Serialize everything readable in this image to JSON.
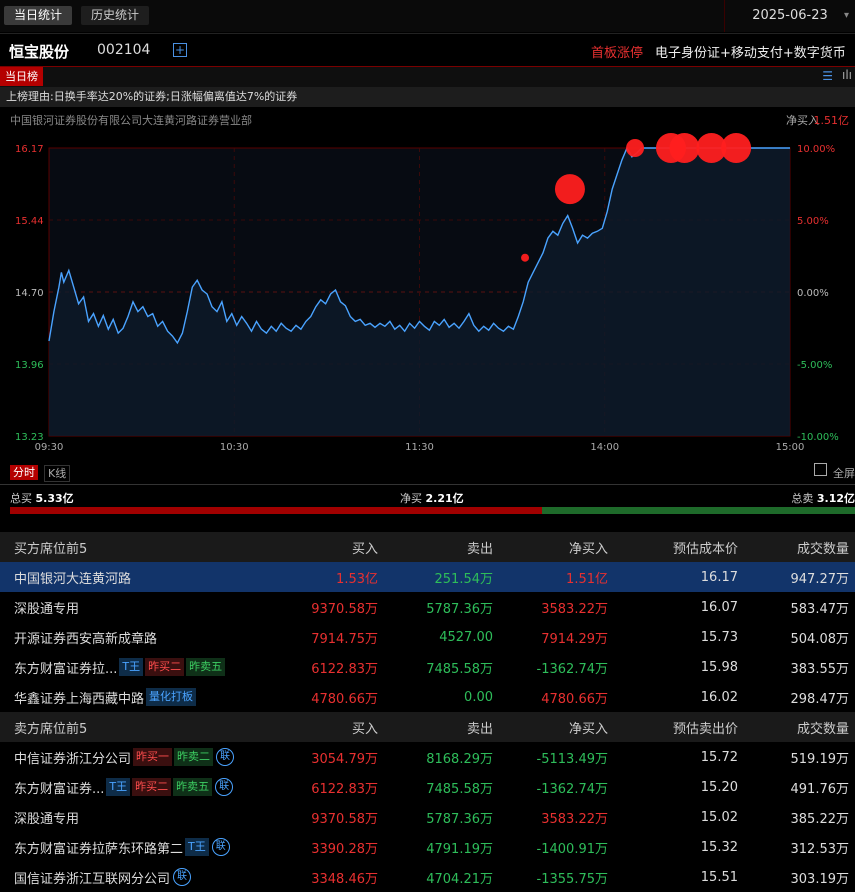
{
  "tabs": {
    "today": "当日统计",
    "history": "历史统计"
  },
  "date": "2025-06-23",
  "stock": {
    "name": "恒宝股份",
    "code": "002104",
    "status": "首板涨停",
    "concepts": "电子身份证+移动支付+数字货币"
  },
  "list_tag": "当日榜",
  "reason": "上榜理由:日换手率达20%的证券;日涨幅偏离值达7%的证券",
  "branch": {
    "name": "中国银河证券股份有限公司大连黄河路证券营业部",
    "net_label": "净买入",
    "net_value": "1.51亿"
  },
  "colors": {
    "up": "#e83030",
    "down": "#2ebd5a",
    "line": "#4aa3ff",
    "highlight": "#12346a"
  },
  "chart_data": {
    "type": "line",
    "y_left_ticks": [
      "16.17",
      "15.44",
      "14.70",
      "13.96",
      "13.23"
    ],
    "y_right_ticks": [
      "10.00%",
      "5.00%",
      "0.00%",
      "-5.00%",
      "-10.00%"
    ],
    "x_ticks": [
      "09:30",
      "10:30",
      "11:30",
      "14:00",
      "15:00"
    ],
    "ylim": [
      13.23,
      16.17
    ],
    "prev_close": 14.7,
    "series": [
      {
        "points": [
          [
            0,
            14.2
          ],
          [
            2,
            14.5
          ],
          [
            4,
            14.75
          ],
          [
            5,
            14.9
          ],
          [
            6,
            14.8
          ],
          [
            8,
            14.92
          ],
          [
            10,
            14.75
          ],
          [
            12,
            14.58
          ],
          [
            14,
            14.65
          ],
          [
            16,
            14.4
          ],
          [
            18,
            14.48
          ],
          [
            20,
            14.35
          ],
          [
            22,
            14.46
          ],
          [
            24,
            14.32
          ],
          [
            26,
            14.42
          ],
          [
            28,
            14.28
          ],
          [
            30,
            14.33
          ],
          [
            32,
            14.45
          ],
          [
            34,
            14.6
          ],
          [
            36,
            14.5
          ],
          [
            38,
            14.55
          ],
          [
            40,
            14.45
          ],
          [
            42,
            14.48
          ],
          [
            44,
            14.35
          ],
          [
            46,
            14.4
          ],
          [
            48,
            14.3
          ],
          [
            50,
            14.25
          ],
          [
            52,
            14.18
          ],
          [
            54,
            14.28
          ],
          [
            56,
            14.5
          ],
          [
            58,
            14.75
          ],
          [
            60,
            14.82
          ],
          [
            62,
            14.72
          ],
          [
            64,
            14.68
          ],
          [
            66,
            14.55
          ],
          [
            68,
            14.5
          ],
          [
            70,
            14.6
          ],
          [
            72,
            14.4
          ],
          [
            74,
            14.48
          ],
          [
            76,
            14.36
          ],
          [
            78,
            14.45
          ],
          [
            80,
            14.38
          ],
          [
            82,
            14.3
          ],
          [
            84,
            14.4
          ],
          [
            86,
            14.32
          ],
          [
            88,
            14.28
          ],
          [
            90,
            14.35
          ],
          [
            92,
            14.3
          ],
          [
            94,
            14.38
          ],
          [
            96,
            14.33
          ],
          [
            98,
            14.3
          ],
          [
            100,
            14.36
          ],
          [
            102,
            14.32
          ],
          [
            104,
            14.4
          ],
          [
            106,
            14.45
          ],
          [
            108,
            14.55
          ],
          [
            110,
            14.62
          ],
          [
            112,
            14.58
          ],
          [
            114,
            14.68
          ],
          [
            116,
            14.72
          ],
          [
            118,
            14.6
          ],
          [
            120,
            14.56
          ],
          [
            122,
            14.45
          ],
          [
            124,
            14.4
          ],
          [
            126,
            14.42
          ],
          [
            128,
            14.36
          ],
          [
            130,
            14.38
          ],
          [
            132,
            14.34
          ],
          [
            134,
            14.38
          ],
          [
            136,
            14.35
          ],
          [
            138,
            14.4
          ],
          [
            140,
            14.32
          ],
          [
            142,
            14.36
          ],
          [
            144,
            14.3
          ],
          [
            146,
            14.38
          ],
          [
            148,
            14.33
          ],
          [
            150,
            14.4
          ],
          [
            152,
            14.35
          ],
          [
            154,
            14.31
          ],
          [
            156,
            14.4
          ],
          [
            158,
            14.36
          ],
          [
            160,
            14.42
          ],
          [
            162,
            14.34
          ],
          [
            164,
            14.38
          ],
          [
            166,
            14.33
          ],
          [
            168,
            14.4
          ],
          [
            170,
            14.48
          ],
          [
            172,
            14.36
          ],
          [
            174,
            14.3
          ],
          [
            176,
            14.35
          ],
          [
            178,
            14.31
          ],
          [
            180,
            14.38
          ],
          [
            182,
            14.33
          ],
          [
            184,
            14.3
          ],
          [
            186,
            14.35
          ],
          [
            188,
            14.32
          ],
          [
            190,
            14.45
          ],
          [
            192,
            14.6
          ],
          [
            194,
            14.8
          ],
          [
            196,
            14.9
          ],
          [
            198,
            15.0
          ],
          [
            200,
            15.1
          ],
          [
            202,
            15.25
          ],
          [
            204,
            15.32
          ],
          [
            206,
            15.28
          ],
          [
            208,
            15.4
          ],
          [
            210,
            15.48
          ],
          [
            212,
            15.35
          ],
          [
            214,
            15.2
          ],
          [
            216,
            15.28
          ],
          [
            218,
            15.25
          ],
          [
            220,
            15.3
          ],
          [
            222,
            15.32
          ],
          [
            224,
            15.35
          ],
          [
            226,
            15.52
          ],
          [
            228,
            15.75
          ],
          [
            230,
            15.9
          ],
          [
            232,
            16.05
          ],
          [
            234,
            16.17
          ],
          [
            236,
            16.08
          ],
          [
            238,
            16.12
          ],
          [
            240,
            16.17
          ],
          [
            300,
            16.17
          ]
        ],
        "markers": [
          {
            "t": 212,
            "v": 15.05,
            "size": "small"
          },
          {
            "t": 232,
            "v": 15.75,
            "size": "large"
          },
          {
            "t": 261,
            "v": 16.17,
            "size": "medium"
          },
          {
            "t": 277,
            "v": 16.17,
            "size": "large"
          },
          {
            "t": 283,
            "v": 16.17,
            "size": "large"
          },
          {
            "t": 295,
            "v": 16.17,
            "size": "large"
          },
          {
            "t": 306,
            "v": 16.17,
            "size": "large"
          }
        ]
      }
    ]
  },
  "modes": {
    "minute": "分时",
    "kline": "K线",
    "fullscreen": "全屏"
  },
  "summary": {
    "total_buy_label": "总买",
    "total_buy": "5.33亿",
    "net_label": "净买",
    "net": "2.21亿",
    "total_sell_label": "总卖",
    "total_sell": "3.12亿",
    "buy_ratio": 0.63
  },
  "buy_header": [
    "买方席位前5",
    "买入",
    "卖出",
    "净买入",
    "预估成本价",
    "成交数量"
  ],
  "buy_rows": [
    {
      "name": "中国银河大连黄河路",
      "tags": [],
      "lian": false,
      "buy": "1.53亿",
      "sell": "251.54万",
      "net": "1.51亿",
      "price": "16.17",
      "qty": "947.27万",
      "highlight": true
    },
    {
      "name": "深股通专用",
      "tags": [],
      "lian": false,
      "buy": "9370.58万",
      "sell": "5787.36万",
      "net": "3583.22万",
      "price": "16.07",
      "qty": "583.47万"
    },
    {
      "name": "开源证券西安高新成章路",
      "tags": [],
      "lian": false,
      "buy": "7914.75万",
      "sell": "4527.00",
      "net": "7914.29万",
      "price": "15.73",
      "qty": "504.08万"
    },
    {
      "name": "东方财富证券拉...",
      "tags": [
        {
          "text": "T王",
          "c": "blue"
        },
        {
          "text": "昨买二",
          "c": "red"
        },
        {
          "text": "昨卖五",
          "c": "green"
        }
      ],
      "lian": false,
      "buy": "6122.83万",
      "sell": "7485.58万",
      "net": "-1362.74万",
      "price": "15.98",
      "qty": "383.55万"
    },
    {
      "name": "华鑫证券上海西藏中路",
      "tags": [
        {
          "text": "量化打板",
          "c": "blue"
        }
      ],
      "lian": false,
      "buy": "4780.66万",
      "sell": "0.00",
      "net": "4780.66万",
      "price": "16.02",
      "qty": "298.47万"
    }
  ],
  "sell_header": [
    "卖方席位前5",
    "买入",
    "卖出",
    "净买入",
    "预估卖出价",
    "成交数量"
  ],
  "sell_rows": [
    {
      "name": "中信证券浙江分公司",
      "tags": [
        {
          "text": "昨买一",
          "c": "red"
        },
        {
          "text": "昨卖二",
          "c": "green"
        }
      ],
      "lian": true,
      "buy": "3054.79万",
      "sell": "8168.29万",
      "net": "-5113.49万",
      "price": "15.72",
      "qty": "519.19万"
    },
    {
      "name": "东方财富证券...",
      "tags": [
        {
          "text": "T王",
          "c": "blue"
        },
        {
          "text": "昨买二",
          "c": "red"
        },
        {
          "text": "昨卖五",
          "c": "green"
        }
      ],
      "lian": true,
      "buy": "6122.83万",
      "sell": "7485.58万",
      "net": "-1362.74万",
      "price": "15.20",
      "qty": "491.76万"
    },
    {
      "name": "深股通专用",
      "tags": [],
      "lian": false,
      "buy": "9370.58万",
      "sell": "5787.36万",
      "net": "3583.22万",
      "price": "15.02",
      "qty": "385.22万"
    },
    {
      "name": "东方财富证券拉萨东环路第二",
      "tags": [
        {
          "text": "T王",
          "c": "blue"
        }
      ],
      "lian": true,
      "buy": "3390.28万",
      "sell": "4791.19万",
      "net": "-1400.91万",
      "price": "15.32",
      "qty": "312.53万"
    },
    {
      "name": "国信证券浙江互联网分公司",
      "tags": [],
      "lian": true,
      "buy": "3348.46万",
      "sell": "4704.21万",
      "net": "-1355.75万",
      "price": "15.51",
      "qty": "303.19万"
    }
  ],
  "lian_label": "联"
}
